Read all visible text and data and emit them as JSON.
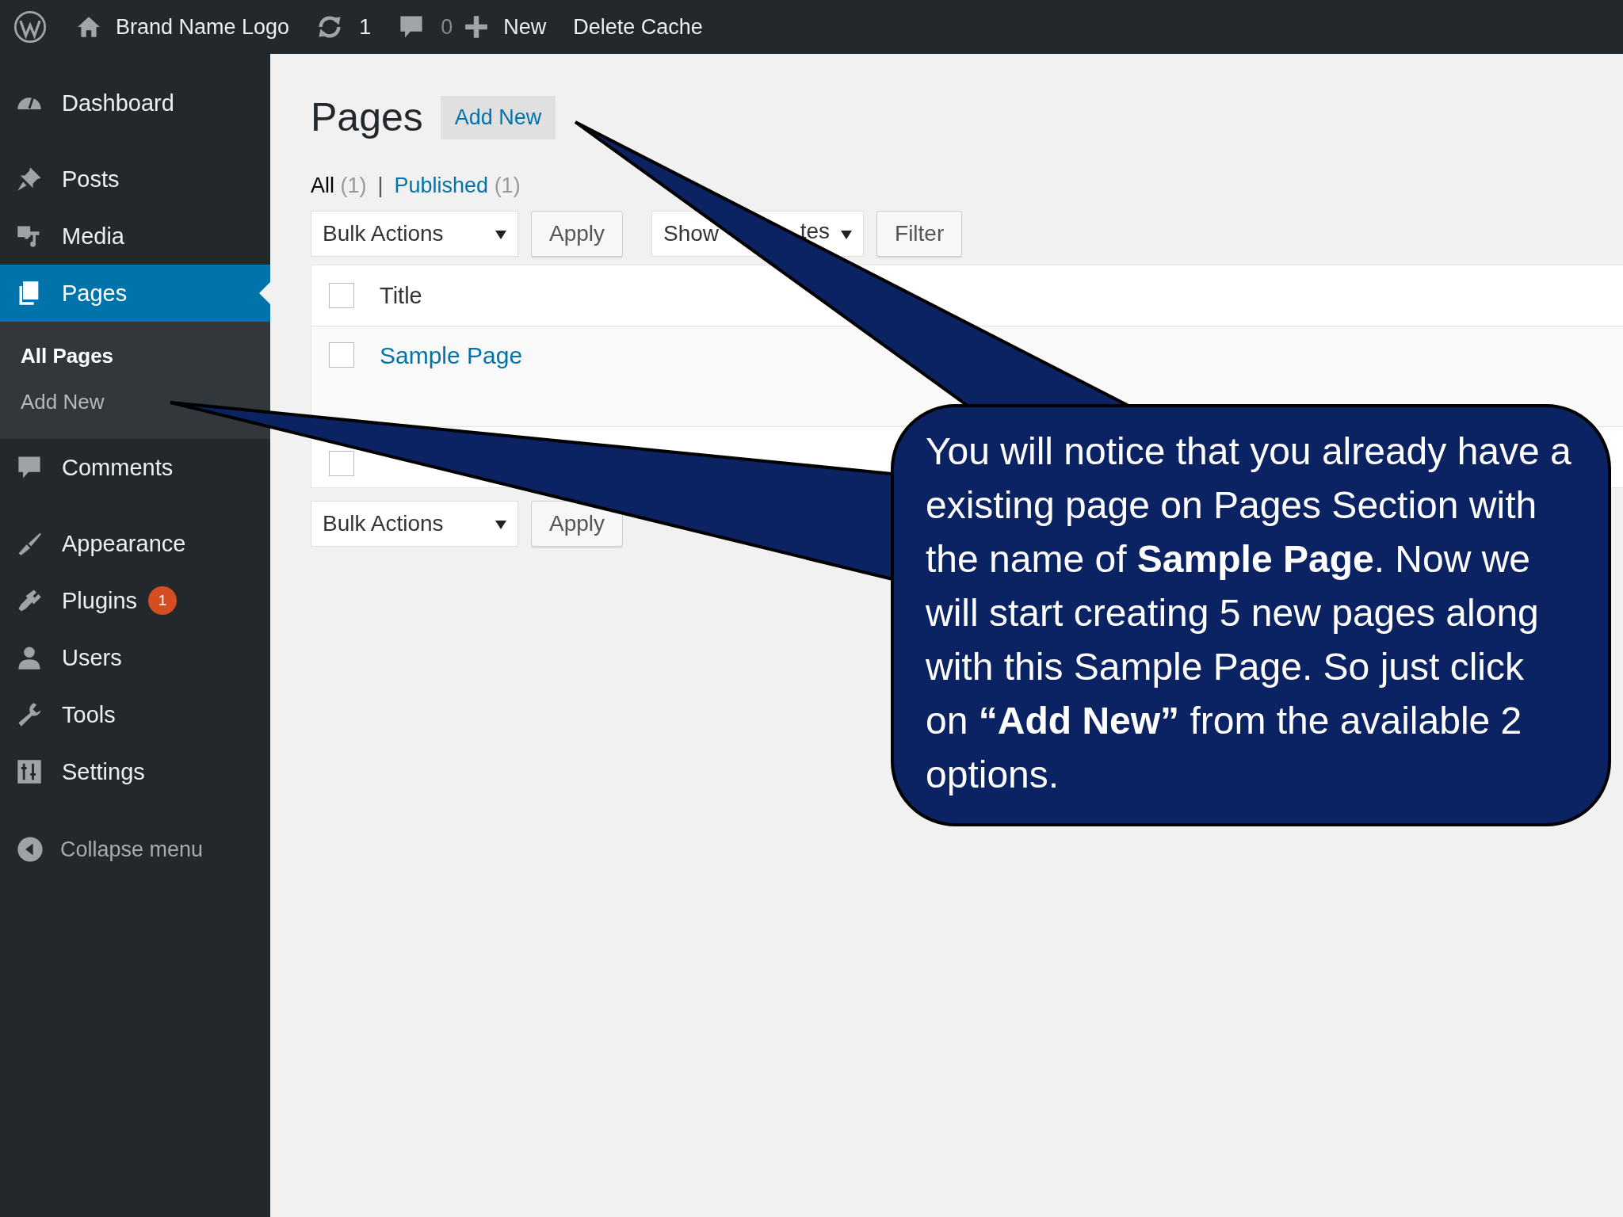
{
  "top_bar": {
    "site_name": "Brand Name Logo",
    "updates": "1",
    "comments": "0",
    "new_label": "New",
    "delete_cache": "Delete Cache"
  },
  "sidebar": {
    "items": [
      {
        "label": "Dashboard",
        "selected": false
      },
      {
        "label": "Posts",
        "selected": false
      },
      {
        "label": "Media",
        "selected": false
      },
      {
        "label": "Pages",
        "selected": true,
        "submenu": [
          {
            "label": "All Pages",
            "selected": true
          },
          {
            "label": "Add New",
            "selected": false
          }
        ]
      },
      {
        "label": "Comments",
        "selected": false
      },
      {
        "label": "Appearance",
        "selected": false
      },
      {
        "label": "Plugins",
        "selected": false,
        "badge": "1"
      },
      {
        "label": "Users",
        "selected": false
      },
      {
        "label": "Tools",
        "selected": false
      },
      {
        "label": "Settings",
        "selected": false
      }
    ],
    "collapse": "Collapse menu"
  },
  "page": {
    "title": "Pages",
    "add_new": "Add New",
    "filters": [
      {
        "label": "All",
        "count": "(1)",
        "selected": true
      },
      {
        "label": "Published",
        "count": "(1)",
        "selected": false
      }
    ],
    "separator": "|",
    "top_actions": {
      "bulk": "Bulk Actions",
      "apply": "Apply",
      "dates": "Show",
      "dates_tail": "tes",
      "filter": "Filter"
    },
    "table": {
      "header": {
        "title": "Title",
        "checked": false
      },
      "rows": [
        {
          "title": "Sample Page",
          "checked": false
        }
      ],
      "footer": {
        "checked": false
      }
    },
    "bottom_actions": {
      "bulk": "Bulk Actions",
      "apply": "Apply"
    }
  },
  "callout": {
    "text": "You will notice that you already have a existing page on Pages Section with the name of **Sample Page**.  Now we will start creating 5 new pages along with this Sample Page. So just click on **“Add New”** from the available 2 options."
  }
}
